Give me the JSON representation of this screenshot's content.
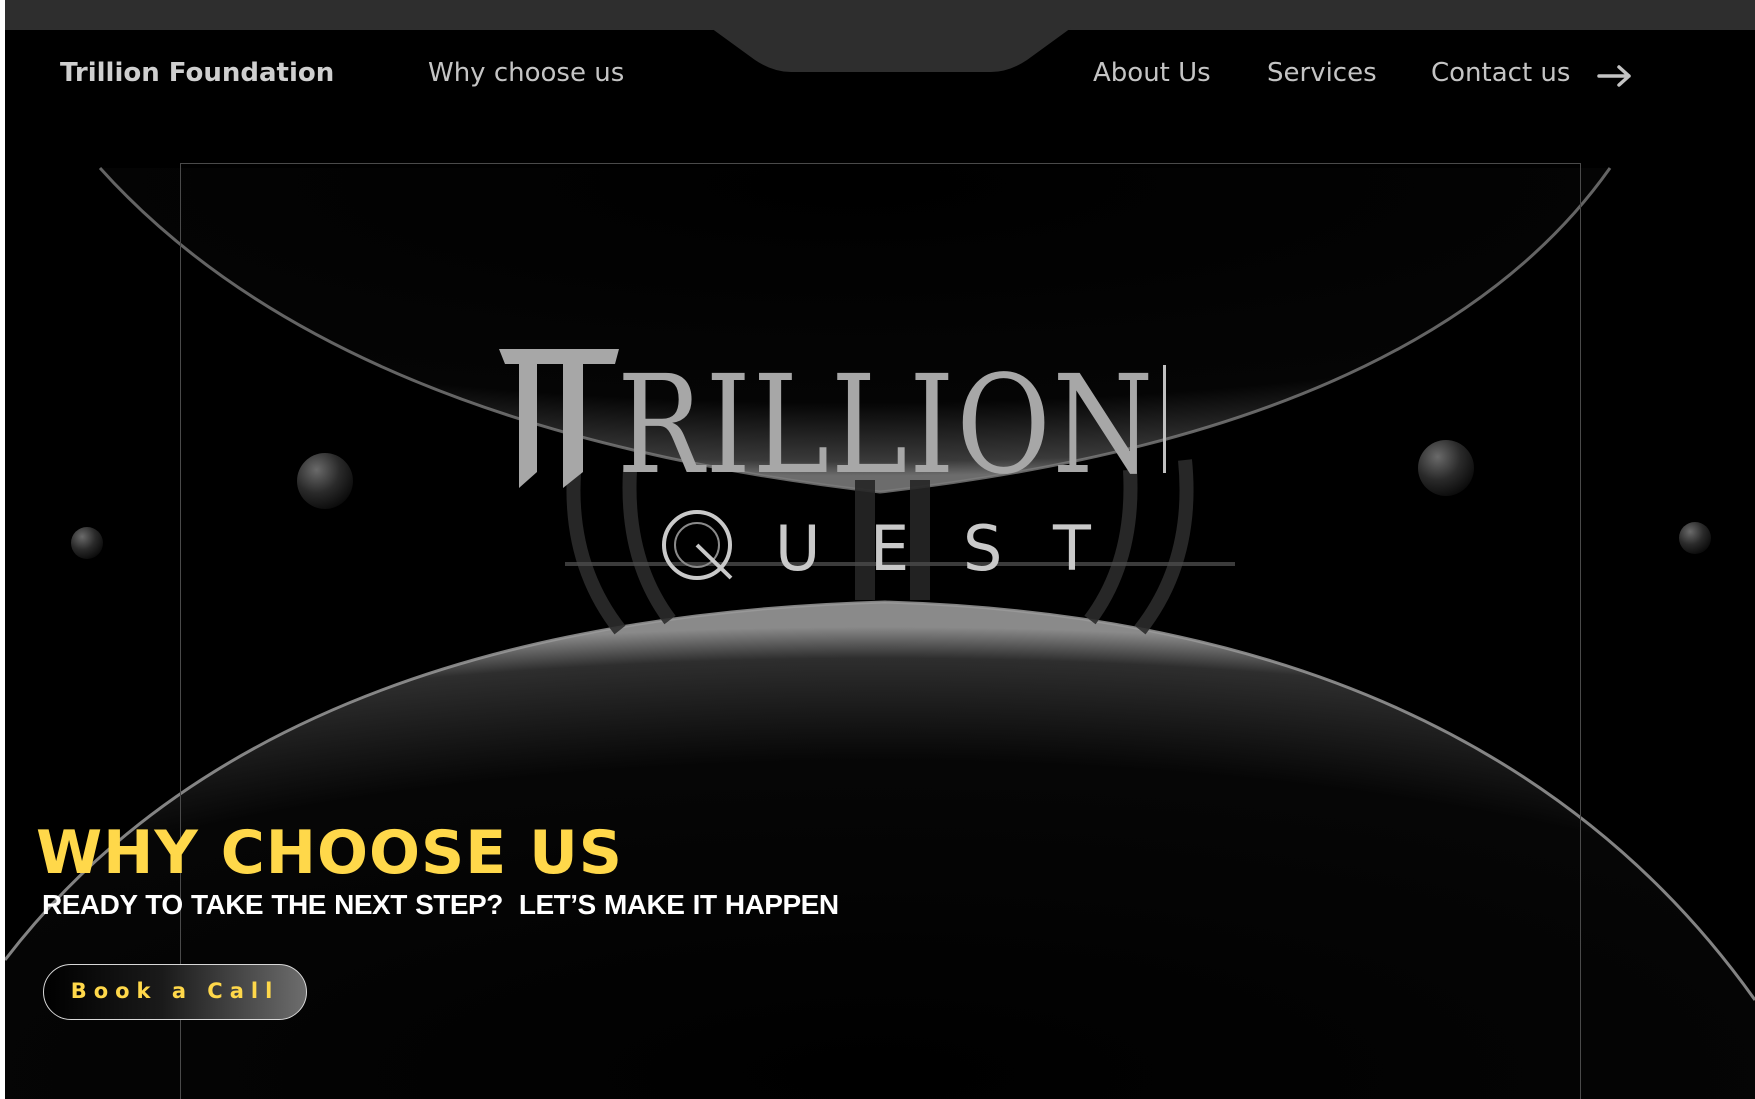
{
  "nav": {
    "brand": "Trillion Foundation",
    "why_choose_us": "Why choose us",
    "about_us": "About Us",
    "services": "Services",
    "contact_us": "Contact us"
  },
  "logo": {
    "title": "TRILLION",
    "subtitle_letters": [
      "U",
      "E",
      "S",
      "T"
    ]
  },
  "hero": {
    "headline": "WHY CHOOSE US",
    "subline_part1": "READY TO TAKE THE NEXT STEP?",
    "subline_part2": "LET’S MAKE IT HAPPEN",
    "cta_label": "Book a Call"
  },
  "colors": {
    "accent": "#ffd84a",
    "background": "#000000",
    "topbar": "#2e2e2e",
    "nav_text": "#c4c4c4"
  }
}
